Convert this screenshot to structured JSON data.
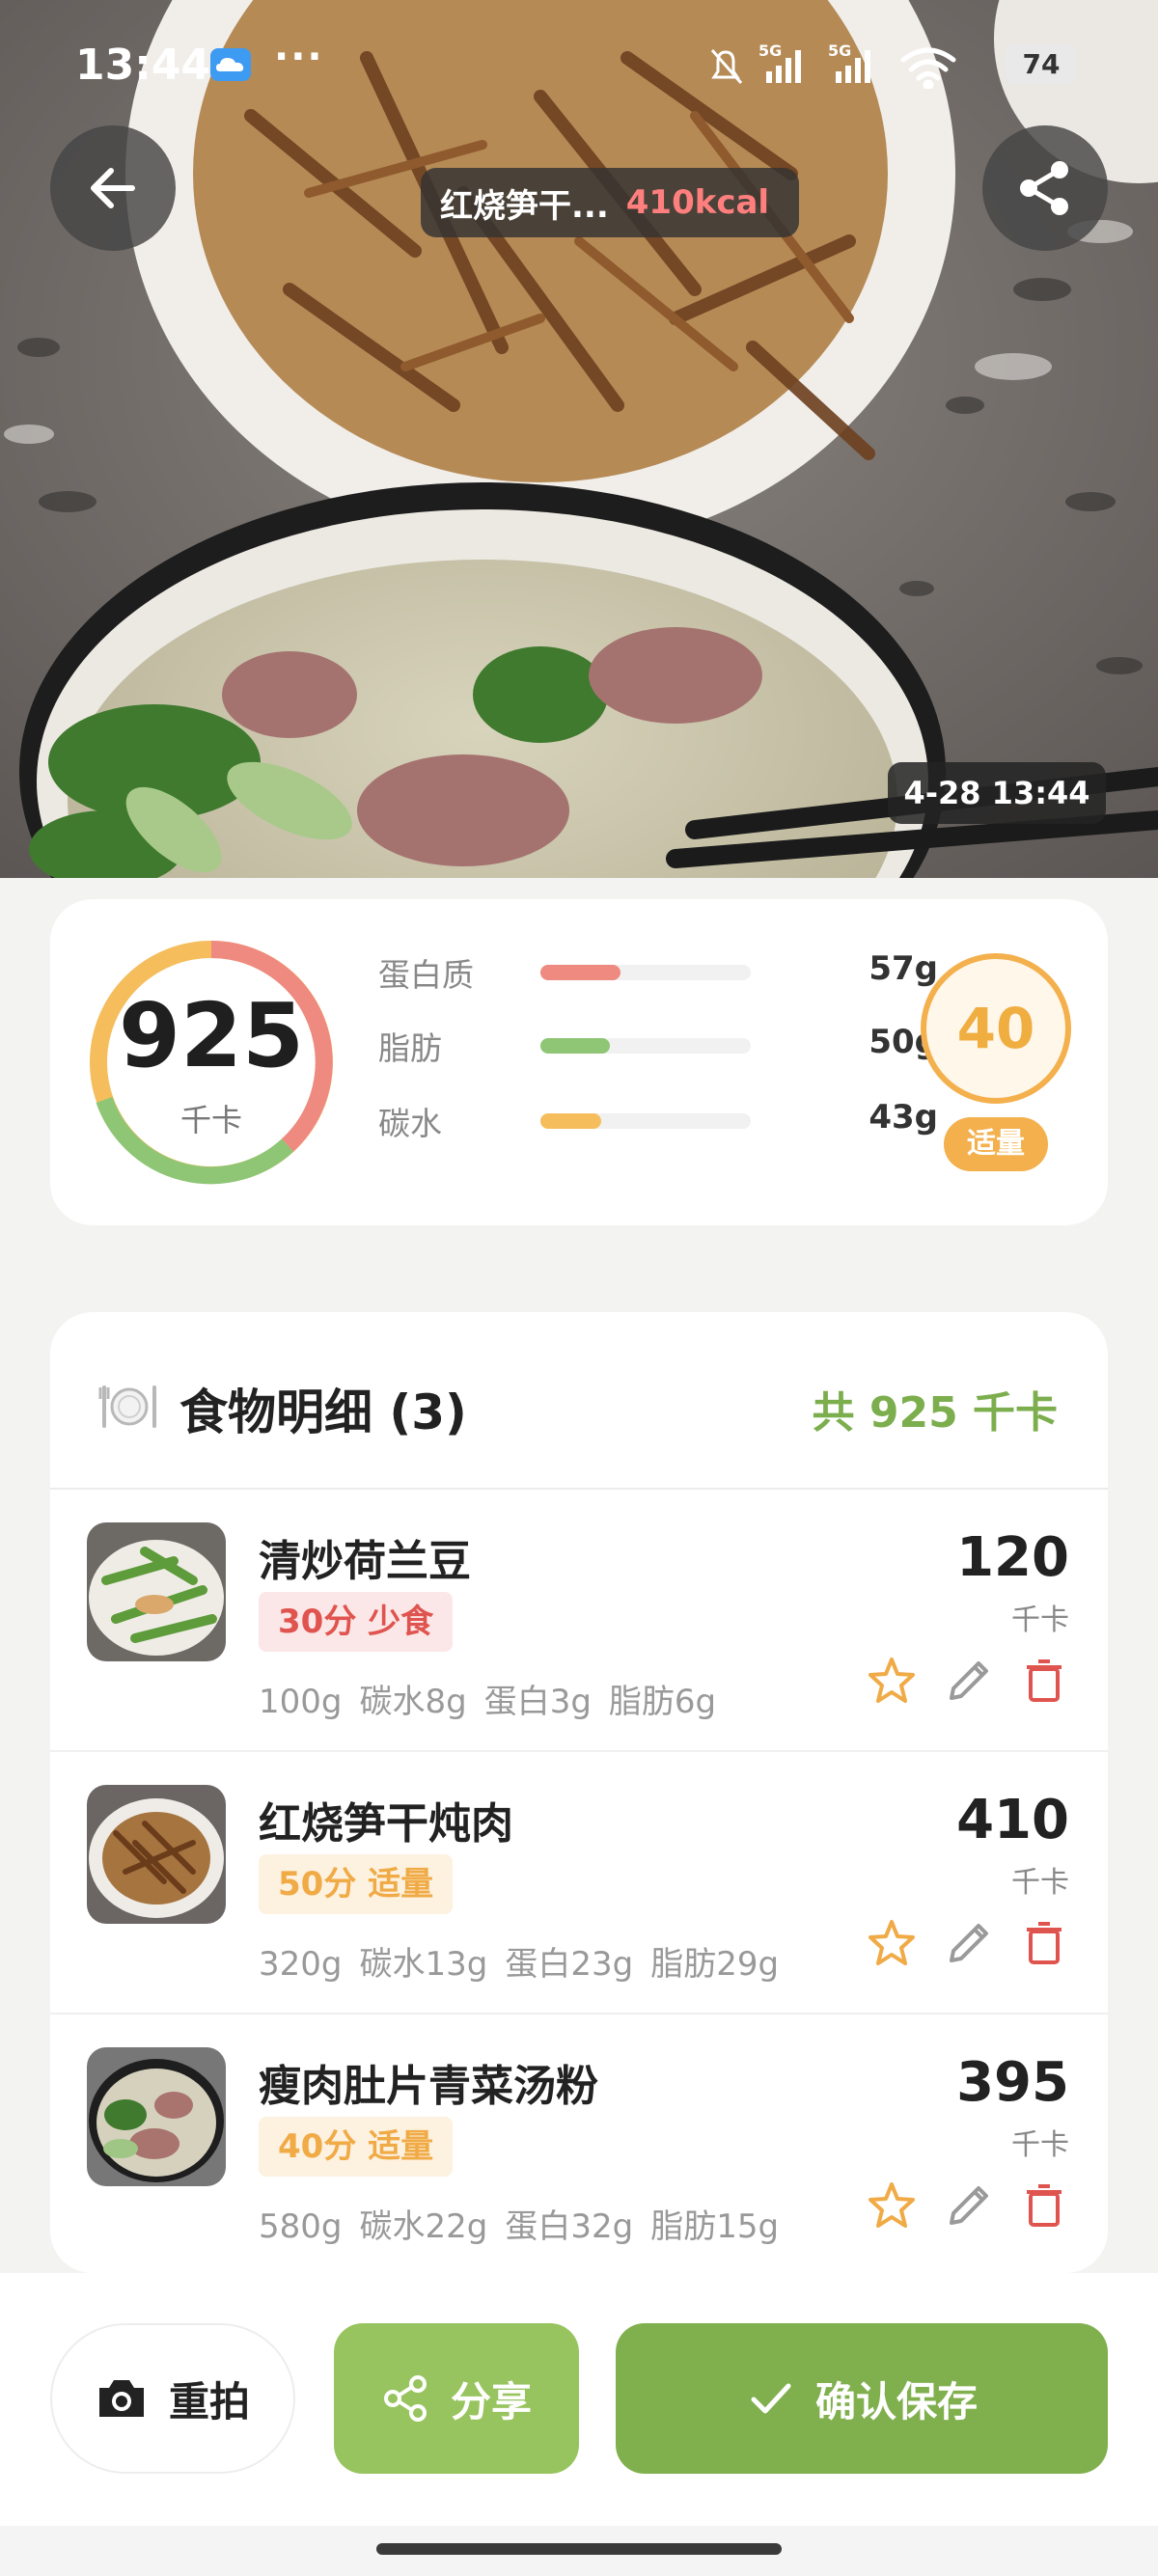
{
  "status_bar": {
    "time": "13:44",
    "dots": "···",
    "signal_1": "5G",
    "signal_2": "5G",
    "battery": "74"
  },
  "header": {
    "title": "红烧笋干...",
    "kcal": "410kcal"
  },
  "photo": {
    "timestamp": "4-28 13:44"
  },
  "summary": {
    "calories": "925",
    "calories_unit": "千卡",
    "macros": [
      {
        "name": "蛋白质",
        "value": "57g",
        "fill": 0.38,
        "color": "#ee8a80"
      },
      {
        "name": "脂肪",
        "value": "50g",
        "fill": 0.33,
        "color": "#8fc676"
      },
      {
        "name": "碳水",
        "value": "43g",
        "fill": 0.29,
        "color": "#f5bd5c"
      }
    ],
    "score": "40",
    "score_label": "适量",
    "ring_colors": {
      "protein": "#ee8a80",
      "fat": "#8fc676",
      "carb": "#f5bd5c"
    }
  },
  "details": {
    "title": "食物明细 (3)",
    "total": "共 925 千卡",
    "items": [
      {
        "name": "清炒荷兰豆",
        "tag": "30分 少食",
        "weight": "100g",
        "carb": "碳水8g",
        "protein": "蛋白3g",
        "fat": "脂肪6g",
        "kcal": "120",
        "unit": "千卡"
      },
      {
        "name": "红烧笋干炖肉",
        "tag": "50分 适量",
        "weight": "320g",
        "carb": "碳水13g",
        "protein": "蛋白23g",
        "fat": "脂肪29g",
        "kcal": "410",
        "unit": "千卡"
      },
      {
        "name": "瘦肉肚片青菜汤粉",
        "tag": "40分 适量",
        "weight": "580g",
        "carb": "碳水22g",
        "protein": "蛋白32g",
        "fat": "脂肪15g",
        "kcal": "395",
        "unit": "千卡"
      }
    ]
  },
  "actions": {
    "retake": "重拍",
    "share": "分享",
    "save": "确认保存"
  },
  "colors": {
    "accent_green": "#80b04e",
    "share_green": "#97c45e",
    "score_orange": "#f3b04c",
    "delete_red": "#e0544f"
  }
}
